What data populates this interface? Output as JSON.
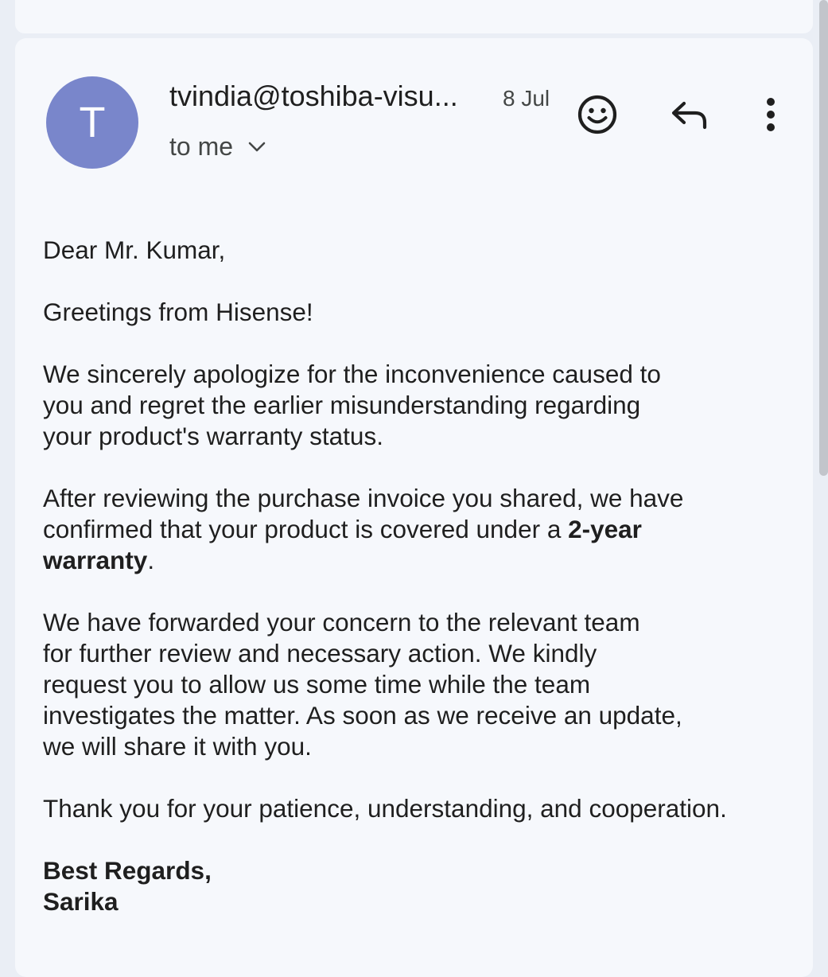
{
  "email": {
    "avatar_letter": "T",
    "sender": "tvindia@toshiba-visu...",
    "date": "8 Jul",
    "recipient": "to me",
    "actions": {
      "emoji": "smiley-icon",
      "reply": "reply-icon",
      "more": "more-vertical-icon"
    },
    "colors": {
      "avatar": "#7986cb",
      "card": "#f6f8fc",
      "background": "#eaeef5"
    },
    "body": {
      "greeting": "Dear Mr. Kumar,",
      "p1": "Greetings from Hisense!",
      "p2_l1": "We sincerely apologize for the inconvenience caused to",
      "p2_l2": "you and regret the earlier misunderstanding regarding",
      "p2_l3": "your product's warranty status.",
      "p3_l1": "After reviewing the purchase invoice you shared, we have",
      "p3_l2_pre": "confirmed that your product is covered under a ",
      "p3_l2_bold": "2-year",
      "p3_l3_bold": "warranty",
      "p3_l3_post": ".",
      "p4_l1": "We have forwarded your concern to the relevant team",
      "p4_l2": "for further review and necessary action. We kindly",
      "p4_l3": "request you to allow us some time while the team",
      "p4_l4": "investigates the matter. As soon as we receive an update,",
      "p4_l5": "we will share it with you.",
      "p5": "Thank you for your patience, understanding, and cooperation.",
      "signoff": "Best Regards,",
      "signature": "Sarika"
    }
  }
}
